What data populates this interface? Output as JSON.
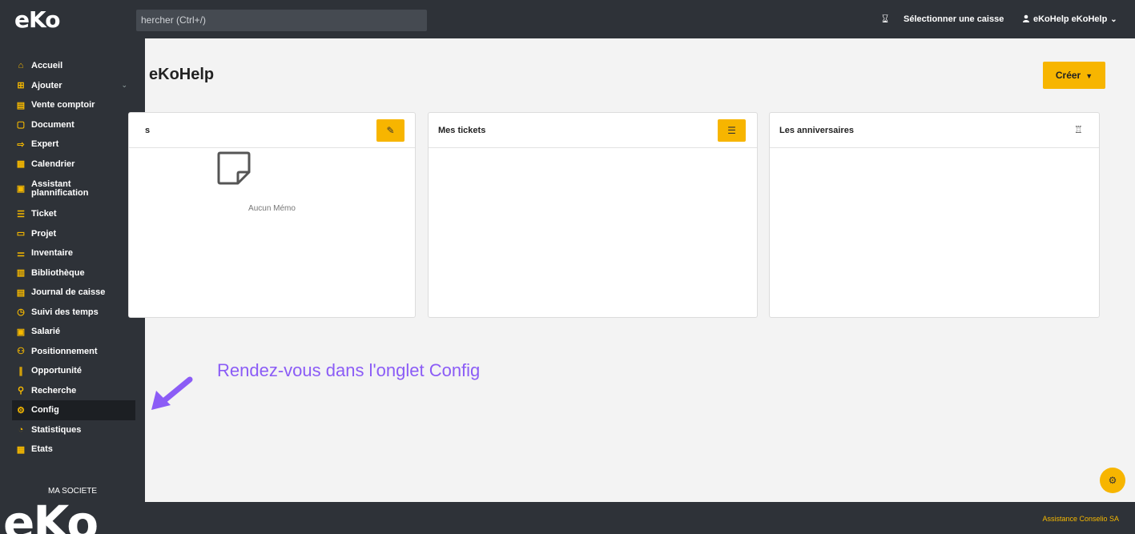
{
  "topbar": {
    "logo": "eKo",
    "search_placeholder": "hercher (Ctrl+/)",
    "caisse_icon": "swap-icon",
    "caisse_label": "Sélectionner une caisse",
    "user_label": "eKoHelp eKoHelp"
  },
  "sidebar": {
    "items": [
      {
        "label": "Accueil",
        "icon": "⌂"
      },
      {
        "label": "Ajouter",
        "icon": "⊞"
      },
      {
        "label": "Vente comptoir",
        "icon": "▤"
      },
      {
        "label": "Document",
        "icon": "▢"
      },
      {
        "label": "Expert",
        "icon": "⇨"
      },
      {
        "label": "Calendrier",
        "icon": "▦"
      },
      {
        "label": "Assistant plannification",
        "icon": "▣"
      },
      {
        "label": "Ticket",
        "icon": "☰"
      },
      {
        "label": "Projet",
        "icon": "▭"
      },
      {
        "label": "Inventaire",
        "icon": "⚌"
      },
      {
        "label": "Bibliothèque",
        "icon": "▥"
      },
      {
        "label": "Journal de caisse",
        "icon": "▤"
      },
      {
        "label": "Suivi des temps",
        "icon": "◷"
      },
      {
        "label": "Salarié",
        "icon": "▣"
      },
      {
        "label": "Positionnement",
        "icon": "⚇"
      },
      {
        "label": "Opportunité",
        "icon": "∥"
      },
      {
        "label": "Recherche",
        "icon": "⚲"
      },
      {
        "label": "Config",
        "icon": "⚙"
      },
      {
        "label": "Statistiques",
        "icon": "◔"
      },
      {
        "label": "Etats",
        "icon": "▦"
      }
    ],
    "societe": "MA SOCIETE",
    "logo": "eKo"
  },
  "main": {
    "title": "eKoHelp",
    "create_label": "Créer",
    "cards": [
      {
        "title": "s",
        "empty_text": "Aucun Mémo"
      },
      {
        "title": "Mes tickets"
      },
      {
        "title": "Les anniversaires"
      }
    ]
  },
  "annotation": "Rendez-vous dans l'onglet Config",
  "footer": "Assistance Conselio SA",
  "colors": {
    "accent": "#f7b500",
    "dark": "#2e3238",
    "annotation": "#8b5cf6"
  }
}
